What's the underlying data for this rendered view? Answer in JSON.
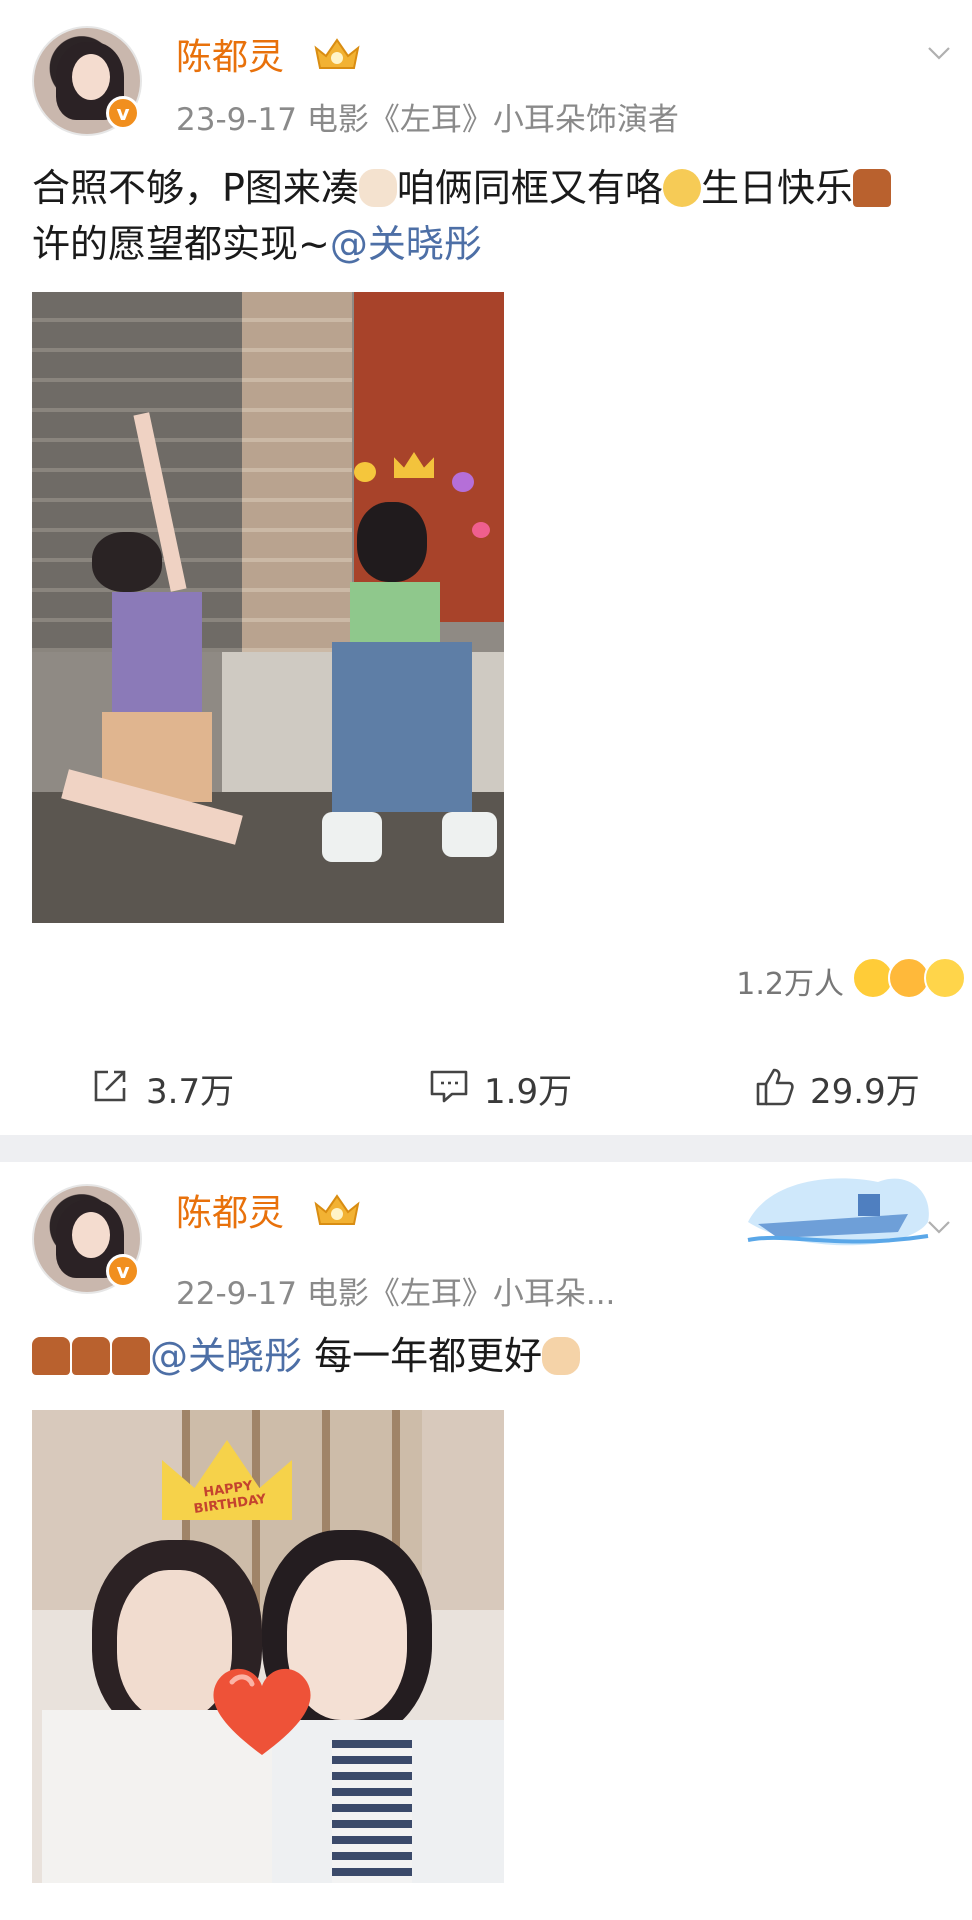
{
  "posts": [
    {
      "username": "陈都灵",
      "meta": "23-9-17   电影《左耳》小耳朵饰演者",
      "content_line1_part1": "合照不够，P图来凑",
      "content_line1_part2": "咱俩同框又有咯",
      "content_line1_part3": "生日快乐",
      "content_line2_text": "许的愿望都实现~",
      "mention": "@关晓彤",
      "reactions_count": "1.2万人",
      "actions": {
        "repost": "3.7万",
        "comment": "1.9万",
        "like": "29.9万"
      }
    },
    {
      "username": "陈都灵",
      "meta": "22-9-17   电影《左耳》小耳朵...",
      "mention": "@关晓彤",
      "content_text": " 每一年都更好",
      "photo_crown_text": "HAPPY BIRTHDAY"
    }
  ],
  "colors": {
    "username": "#e8710b",
    "mention": "#4d6fa6",
    "meta": "#8a8a8a",
    "vip_badge": "#f18f1e",
    "divider": "#eeeff2"
  },
  "icons": {
    "crown": "vip-crown-icon",
    "verified": "verified-v-icon",
    "repost": "repost-icon",
    "comment": "comment-icon",
    "like": "thumbs-up-icon",
    "more": "chevron-down-icon"
  }
}
